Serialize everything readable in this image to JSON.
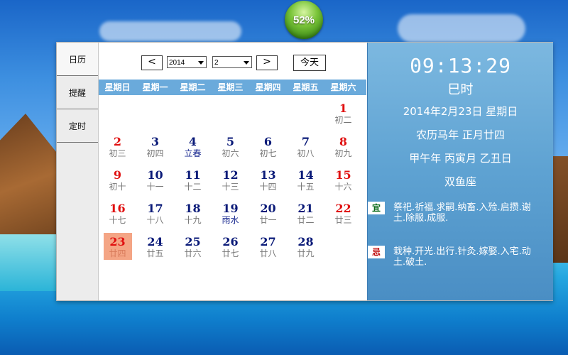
{
  "progress": {
    "label": "52%",
    "value": 0.52
  },
  "tabs": [
    {
      "label": "日历",
      "active": true
    },
    {
      "label": "提醒",
      "active": false
    },
    {
      "label": "定时",
      "active": false
    }
  ],
  "toolbar": {
    "prev_label": "<",
    "next_label": ">",
    "year": "2014",
    "month": "2",
    "today_label": "今天"
  },
  "weekdays": [
    "星期日",
    "星期一",
    "星期二",
    "星期三",
    "星期四",
    "星期五",
    "星期六"
  ],
  "weeks": [
    [
      {
        "n": "",
        "l": ""
      },
      {
        "n": "",
        "l": ""
      },
      {
        "n": "",
        "l": ""
      },
      {
        "n": "",
        "l": ""
      },
      {
        "n": "",
        "l": ""
      },
      {
        "n": "",
        "l": ""
      },
      {
        "n": "1",
        "l": "初二"
      }
    ],
    [
      {
        "n": "2",
        "l": "初三"
      },
      {
        "n": "3",
        "l": "初四"
      },
      {
        "n": "4",
        "l": "立春",
        "term": true
      },
      {
        "n": "5",
        "l": "初六"
      },
      {
        "n": "6",
        "l": "初七"
      },
      {
        "n": "7",
        "l": "初八"
      },
      {
        "n": "8",
        "l": "初九"
      }
    ],
    [
      {
        "n": "9",
        "l": "初十"
      },
      {
        "n": "10",
        "l": "十一"
      },
      {
        "n": "11",
        "l": "十二"
      },
      {
        "n": "12",
        "l": "十三"
      },
      {
        "n": "13",
        "l": "十四"
      },
      {
        "n": "14",
        "l": "十五"
      },
      {
        "n": "15",
        "l": "十六"
      }
    ],
    [
      {
        "n": "16",
        "l": "十七"
      },
      {
        "n": "17",
        "l": "十八"
      },
      {
        "n": "18",
        "l": "十九"
      },
      {
        "n": "19",
        "l": "雨水",
        "term": true
      },
      {
        "n": "20",
        "l": "廿一"
      },
      {
        "n": "21",
        "l": "廿二"
      },
      {
        "n": "22",
        "l": "廿三"
      }
    ],
    [
      {
        "n": "23",
        "l": "廿四",
        "today": true
      },
      {
        "n": "24",
        "l": "廿五"
      },
      {
        "n": "25",
        "l": "廿六"
      },
      {
        "n": "26",
        "l": "廿七"
      },
      {
        "n": "27",
        "l": "廿八"
      },
      {
        "n": "28",
        "l": "廿九"
      },
      {
        "n": "",
        "l": ""
      }
    ]
  ],
  "info": {
    "time": "09:13:29",
    "shichen": "巳时",
    "date": "2014年2月23日  星期日",
    "lunar": "农历马年  正月廿四",
    "ganzhi": "甲午年  丙寅月  乙丑日",
    "zodiac": "双鱼座",
    "yi_label": "宜",
    "yi_text": "祭祀.祈福.求嗣.纳畜.入殓.启攒.谢土.除服.成服.",
    "ji_label": "忌",
    "ji_text": "栽种.开光.出行.针灸.嫁娶.入宅.动土.破土."
  },
  "colors": {
    "weekend": "#e01010",
    "weekday": "#0a1a78",
    "header": "#6aaadb",
    "today_bg": "#f4a585"
  }
}
